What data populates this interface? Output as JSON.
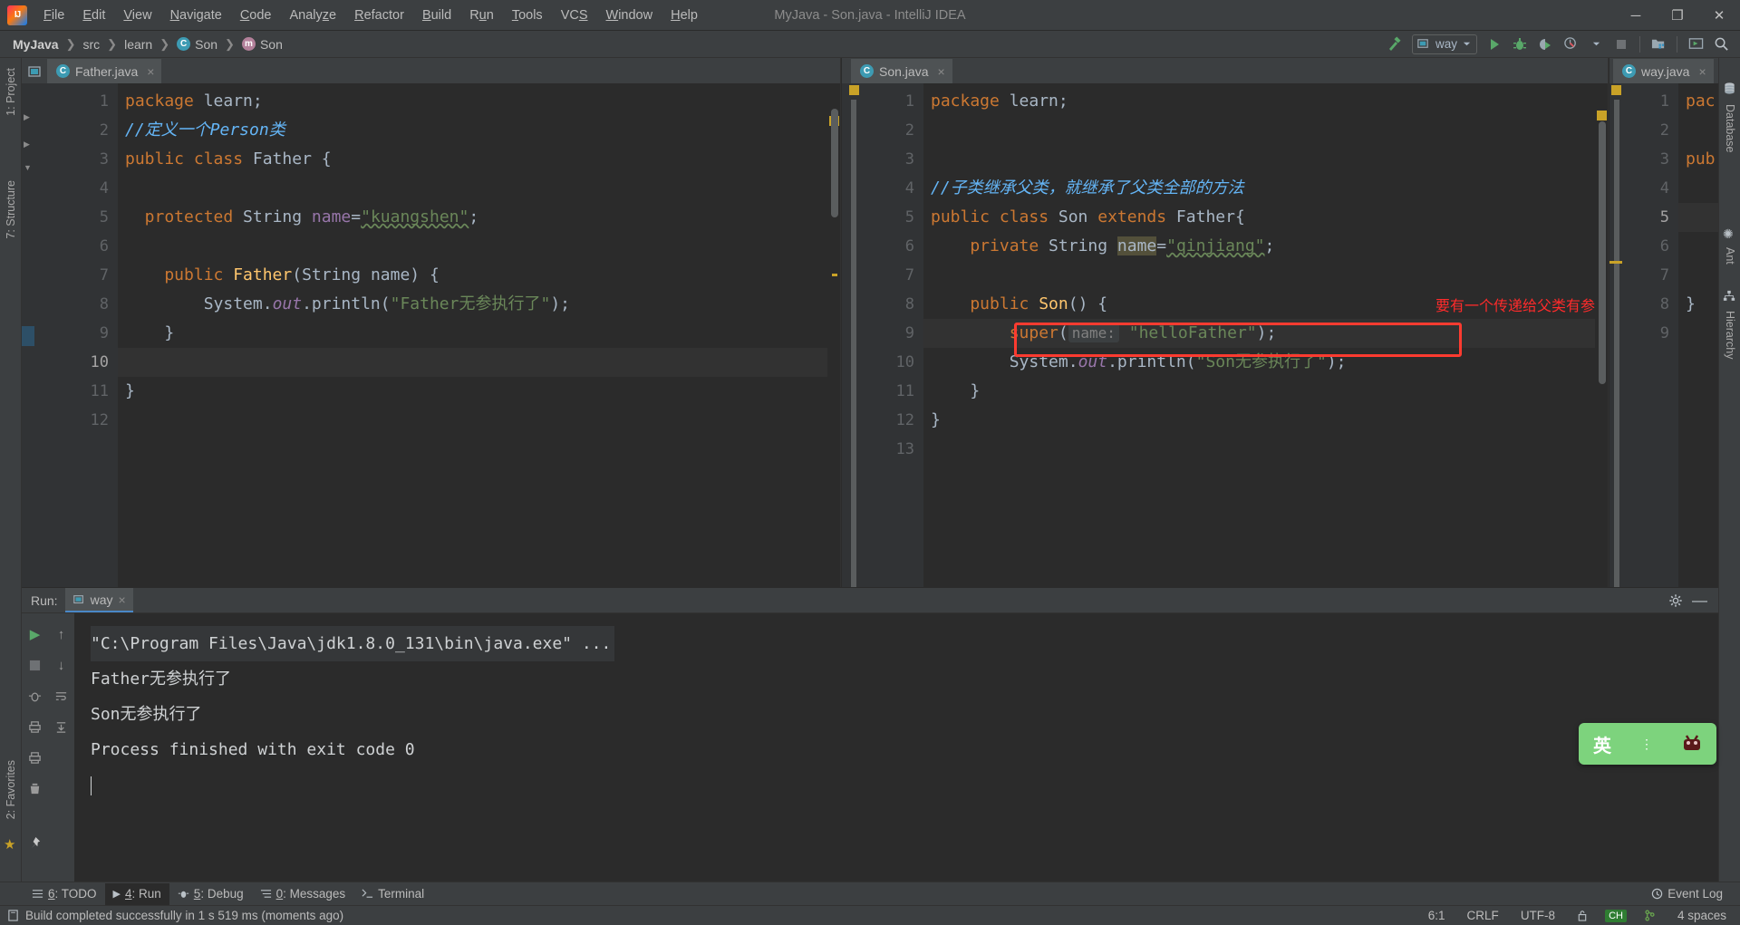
{
  "window": {
    "title": "MyJava - Son.java - IntelliJ IDEA",
    "minimize": "─",
    "maximize": "❐",
    "close": "✕"
  },
  "menu": [
    {
      "label": "File"
    },
    {
      "label": "Edit"
    },
    {
      "label": "View"
    },
    {
      "label": "Navigate"
    },
    {
      "label": "Code"
    },
    {
      "label": "Analyze"
    },
    {
      "label": "Refactor"
    },
    {
      "label": "Build"
    },
    {
      "label": "Run"
    },
    {
      "label": "Tools"
    },
    {
      "label": "VCS"
    },
    {
      "label": "Window"
    },
    {
      "label": "Help"
    }
  ],
  "breadcrumbs": [
    {
      "label": "MyJava",
      "icon": ""
    },
    {
      "label": "src",
      "icon": ""
    },
    {
      "label": "learn",
      "icon": ""
    },
    {
      "label": "Son",
      "icon": "c"
    },
    {
      "label": "Son",
      "icon": "m"
    }
  ],
  "toolbar": {
    "run_config": "way",
    "icons": [
      "build-hammer-icon",
      "run-icon",
      "debug-icon",
      "run-coverage-icon",
      "profiler-icon",
      "stop-icon",
      "project-structure-icon",
      "update-project-icon",
      "search-everywhere-icon"
    ]
  },
  "left_tool_tabs": [
    {
      "label": "1: Project"
    },
    {
      "label": "7: Structure"
    },
    {
      "label": "2: Favorites"
    }
  ],
  "right_tool_tabs": [
    {
      "label": "Database"
    },
    {
      "label": "Ant"
    },
    {
      "label": "Hierarchy"
    }
  ],
  "editors": [
    {
      "tab": {
        "name": "Father.java",
        "icon": "class-icon",
        "close": "×"
      },
      "lines": [
        {
          "n": "1",
          "indent": 0
        },
        {
          "n": "2",
          "indent": 0
        },
        {
          "n": "3",
          "indent": 0
        },
        {
          "n": "4",
          "indent": 0
        },
        {
          "n": "5",
          "indent": 0
        },
        {
          "n": "6",
          "indent": 0
        },
        {
          "n": "7",
          "indent": 0
        },
        {
          "n": "8",
          "indent": 0
        },
        {
          "n": "9",
          "indent": 0
        },
        {
          "n": "10",
          "indent": 0
        },
        {
          "n": "11",
          "indent": 0
        },
        {
          "n": "12",
          "indent": 0
        }
      ],
      "code": {
        "l1_kw": "package",
        "l1_name": " learn;",
        "l2_comment": "//定义一个Person类",
        "l3_kw": "public class",
        "l3_name": " Father {",
        "l5_kw": "  protected",
        "l5_type": " String ",
        "l5_field": "name",
        "l5_eq": "=",
        "l5_str": "\"kuangshen\"",
        "l5_end": ";",
        "l7_kw": "    public",
        "l7_method": " Father",
        "l7_sig_open": "(",
        "l7_type": "String",
        "l7_param": " name",
        "l7_sig_close": ") {",
        "l8_sys": "        System.",
        "l8_out": "out",
        "l8_print": ".println(",
        "l8_str": "\"Father无参执行了\"",
        "l8_end": ");",
        "l9_brace": "    }",
        "l11_brace": "}"
      }
    },
    {
      "tab": {
        "name": "Son.java",
        "icon": "class-icon",
        "close": "×"
      },
      "lines": [
        {
          "n": "1"
        },
        {
          "n": "2"
        },
        {
          "n": "3"
        },
        {
          "n": "4"
        },
        {
          "n": "5"
        },
        {
          "n": "6"
        },
        {
          "n": "7"
        },
        {
          "n": "8"
        },
        {
          "n": "9"
        },
        {
          "n": "10"
        },
        {
          "n": "11"
        },
        {
          "n": "12"
        },
        {
          "n": "13"
        }
      ],
      "code": {
        "l1_kw": "package",
        "l1_name": " learn;",
        "l4_comment": "//子类继承父类，就继承了父类全部的方法",
        "l5_kw": "public class",
        "l5_name": " Son ",
        "l5_kw2": "extends",
        "l5_super": " Father{",
        "l6_kw": "    private",
        "l6_type": " String ",
        "l6_field": "name",
        "l6_eq": "=",
        "l6_str": "\"qinjiang\"",
        "l6_end": ";",
        "l8_kw": "    public",
        "l8_method": " Son",
        "l8_sig": "() {",
        "l9_kw": "        super",
        "l9_open": "(",
        "l9_hint": "name:",
        "l9_str": " \"helloFather\"",
        "l9_end": ");",
        "l10_sys": "        System.",
        "l10_out": "out",
        "l10_print": ".println(",
        "l10_str": "\"Son无参执行了\"",
        "l10_end": ");",
        "l11_brace": "    }",
        "l12_brace": "}"
      },
      "annotation": {
        "note": "要有一个传递给父类有参的参数",
        "note_color": "#ff2b2b",
        "box_color": "#ff3b30"
      }
    },
    {
      "tab": {
        "name": "way.java",
        "icon": "class-run-icon",
        "close": "×"
      },
      "lines": [
        {
          "n": "1"
        },
        {
          "n": "2"
        },
        {
          "n": "3"
        },
        {
          "n": "4"
        },
        {
          "n": "5"
        },
        {
          "n": "6"
        },
        {
          "n": "7"
        },
        {
          "n": "8"
        },
        {
          "n": "9"
        }
      ],
      "code": {
        "l1": "pac",
        "l3": "pub",
        "l8": "}"
      }
    }
  ],
  "run_panel": {
    "label": "Run:",
    "tab": "way",
    "tab_close": "×",
    "settings_icon": "gear-icon",
    "hide_icon": "minimize-icon",
    "side_buttons": [
      "rerun-icon",
      "scroll-up-icon",
      "stop-icon",
      "scroll-down-icon",
      "debugger-icon",
      "soft-wrap-icon",
      "print-icon",
      "scroll-to-end-icon",
      "clear-all-icon",
      "pin-icon"
    ],
    "console": [
      "\"C:\\Program Files\\Java\\jdk1.8.0_131\\bin\\java.exe\" ...",
      "Father无参执行了",
      "Son无参执行了",
      "",
      "Process finished with exit code 0"
    ]
  },
  "ime_popup": {
    "mode": "英",
    "dots": "⋮",
    "icon": "ime-emoji-icon"
  },
  "bottom_tabs": [
    {
      "num": "6",
      "label": ": TODO",
      "icon": "todo-icon",
      "active": false
    },
    {
      "num": "4",
      "label": ": Run",
      "icon": "run-icon",
      "active": true
    },
    {
      "num": "5",
      "label": ": Debug",
      "icon": "debug-icon",
      "active": false
    },
    {
      "num": "0",
      "label": ": Messages",
      "icon": "messages-icon",
      "active": false
    },
    {
      "num": "",
      "label": "Terminal",
      "icon": "terminal-icon",
      "active": false
    }
  ],
  "event_log": "Event Log",
  "statusbar": {
    "message": "Build completed successfully in 1 s 519 ms (moments ago)",
    "icon": "build-status-icon",
    "caret": "6:1",
    "line_separator": "CRLF",
    "encoding": "UTF-8",
    "ime": "CH",
    "indent": "4 spaces",
    "lock_icon": "unlock-icon",
    "branch_icon": "git-branch-icon"
  }
}
